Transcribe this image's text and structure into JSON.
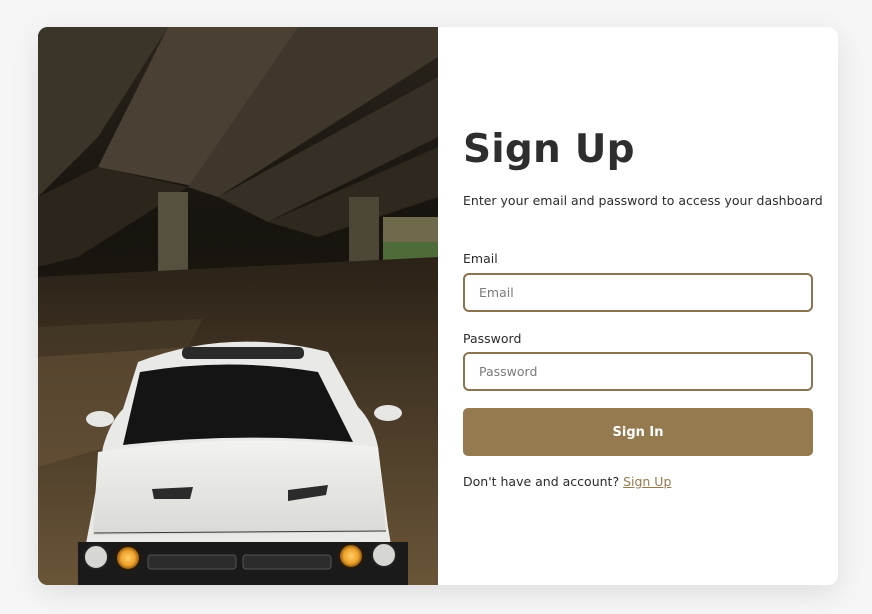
{
  "photo": {
    "description_icon": "car-photo-icon"
  },
  "form": {
    "title": "Sign Up",
    "subtitle": "Enter your email and password to access your dashboard",
    "email_label": "Email",
    "email_placeholder": "Email",
    "email_value": "",
    "password_label": "Password",
    "password_placeholder": "Password",
    "password_value": "",
    "submit_label": "Sign In",
    "footer_prompt": "Don't have and account?",
    "footer_link": "Sign Up"
  },
  "colors": {
    "accent": "#957a4f",
    "input_border": "#8a7350",
    "title": "#2e2e2e",
    "background": "#f6f6f6"
  }
}
